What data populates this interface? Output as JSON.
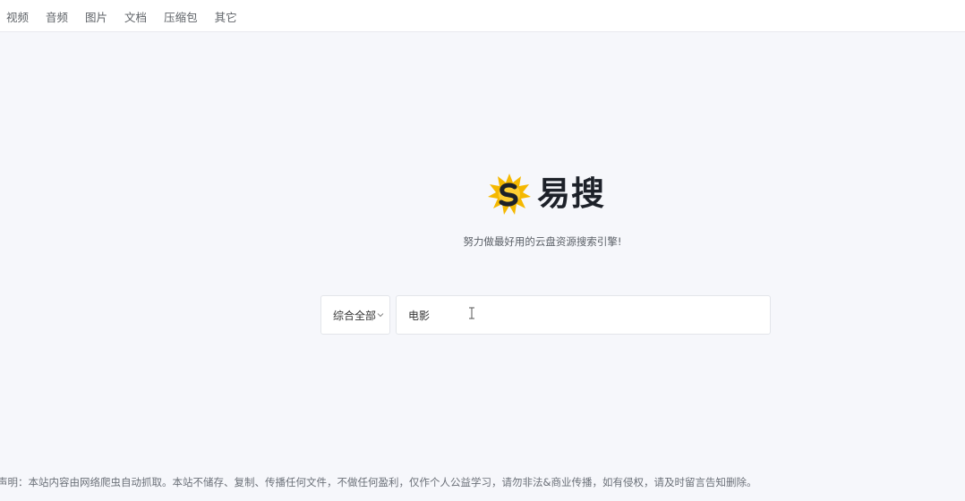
{
  "nav": {
    "items": [
      {
        "label": "视频"
      },
      {
        "label": "音频"
      },
      {
        "label": "图片"
      },
      {
        "label": "文档"
      },
      {
        "label": "压缩包"
      },
      {
        "label": "其它"
      }
    ]
  },
  "brand": {
    "name": "易搜",
    "logo_icon": "star-burst-s-logo",
    "logo_colors": {
      "burst": "#f5b800",
      "letter": "#1d2129"
    }
  },
  "tagline": "努力做最好用的云盘资源搜索引擎!",
  "search": {
    "category": "综合全部",
    "category_icon": "chevron-down-icon",
    "value": "电影"
  },
  "footer": {
    "disclaimer": "声明：本站内容由网络爬虫自动抓取。本站不储存、复制、传播任何文件，不做任何盈利，仅作个人公益学习，请勿非法&商业传播，如有侵权，请及时留言告知删除。"
  }
}
